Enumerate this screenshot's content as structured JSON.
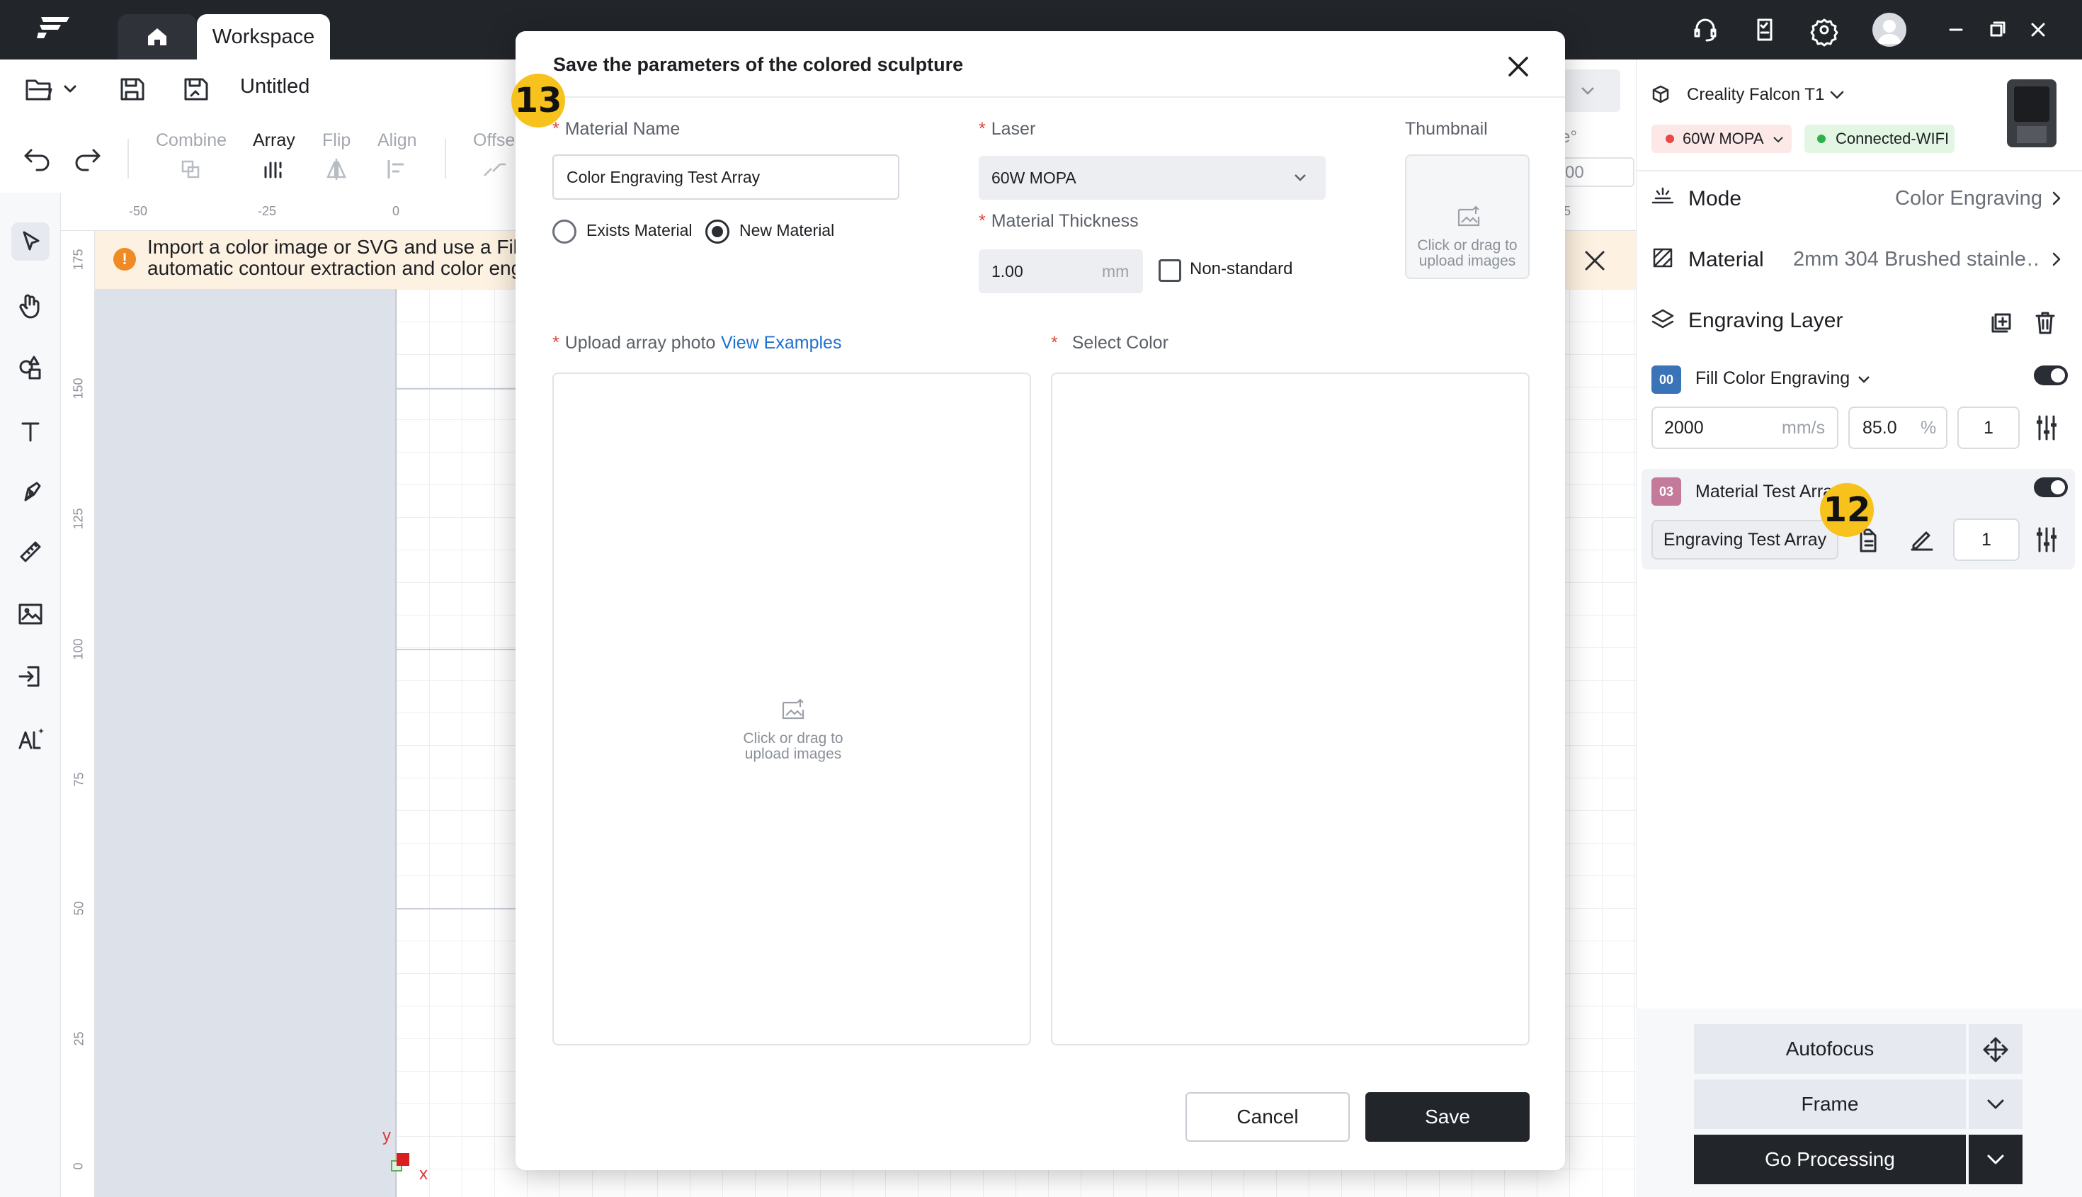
{
  "titlebar": {
    "tab_label": "Workspace"
  },
  "toolbar": {
    "doc_title": "Untitled",
    "tools": [
      "Combine",
      "Array",
      "Flip",
      "Align",
      "Offse"
    ],
    "partial_label": "e°",
    "partial_value": "00"
  },
  "rulers": {
    "top": [
      "-50",
      "-25",
      "0",
      "5"
    ],
    "left": [
      "175",
      "150",
      "125",
      "100",
      "75",
      "50",
      "25",
      "0"
    ]
  },
  "canvas": {
    "notice": "Import a color image or SVG and use a Fil automatic contour extraction and color eng",
    "notice_line1": "Import a color image or SVG and use a Fil",
    "notice_line2": "automatic contour extraction and color eng",
    "axis_x": "x",
    "axis_y": "y"
  },
  "right_panel": {
    "device": "Creality Falcon T1",
    "laser_pill": "60W MOPA",
    "connection_pill": "Connected-WIFI",
    "mode_label": "Mode",
    "mode_value": "Color Engraving",
    "material_label": "Material",
    "material_value": "2mm 304 Brushed stainle…",
    "layer_title": "Engraving Layer",
    "layers": [
      {
        "id": "00",
        "name": "Fill Color Engraving",
        "speed": "2000",
        "speed_unit": "mm/s",
        "power": "85.0",
        "power_unit": "%",
        "passes": "1",
        "color": "#3a73b8"
      },
      {
        "id": "03",
        "name": "Material Test Arra",
        "preset": "Engraving Test Array",
        "passes": "1",
        "color": "#c47a9a"
      }
    ],
    "autofocus": "Autofocus",
    "frame": "Frame",
    "go": "Go Processing"
  },
  "modal": {
    "title": "Save the parameters of the colored sculpture",
    "material_name_label": "Material Name",
    "material_name_value": "Color Engraving Test Array",
    "radio_exists": "Exists Material",
    "radio_new": "New Material",
    "laser_label": "Laser",
    "laser_value": "60W MOPA",
    "thickness_label": "Material Thickness",
    "thickness_value": "1.00",
    "thickness_unit": "mm",
    "nonstandard": "Non-standard",
    "thumbnail_label": "Thumbnail",
    "upload_hint": "Click or drag to upload images",
    "upload_hint_l1": "Click or drag to",
    "upload_hint_l2": "upload images",
    "array_label": "Upload array photo",
    "view_examples": "View Examples",
    "color_label": "Select Color",
    "cancel": "Cancel",
    "save": "Save"
  },
  "step_badges": [
    "13",
    "12"
  ],
  "colors": {
    "accent": "#2a2d33",
    "link": "#1f6fd1",
    "required": "#e0453a",
    "badge": "#f7c21b",
    "notice_bg": "#fdf1e1"
  }
}
